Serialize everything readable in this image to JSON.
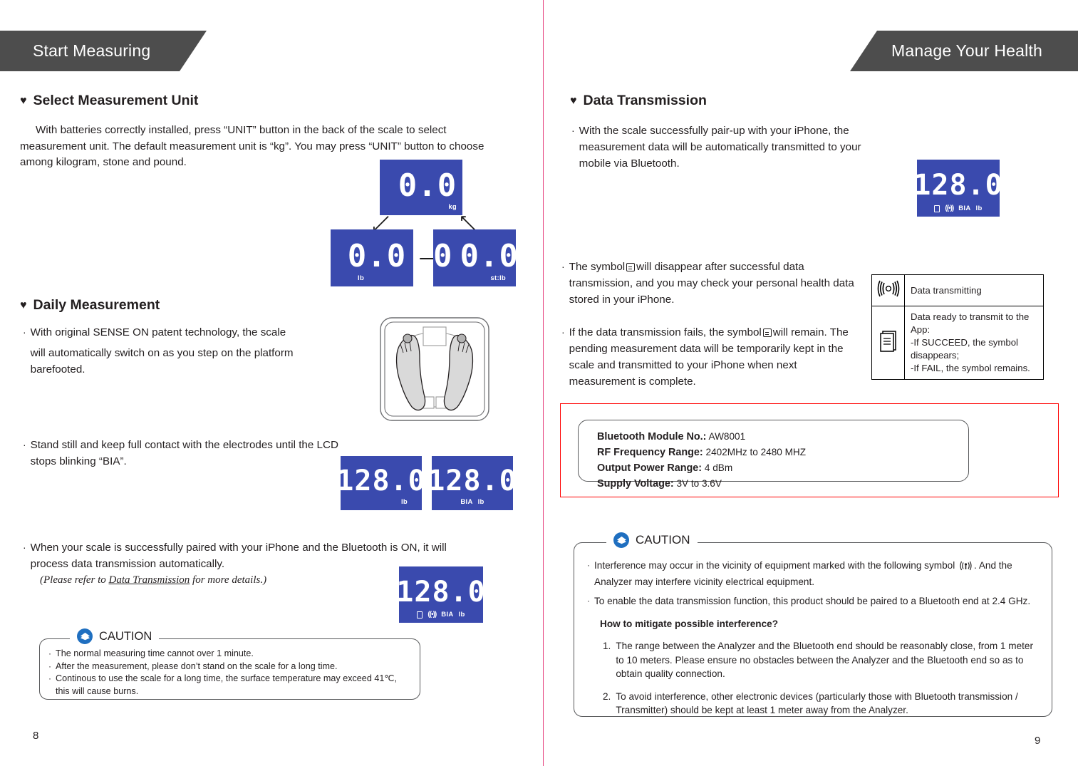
{
  "colors": {
    "banner_bg": "#4D4D4D",
    "lcd_blue": "#3A4AAE",
    "caution_icon_blue": "#1F6FC0",
    "spec_border_red": "#FF0000",
    "spine_pink": "#E6417F"
  },
  "left_page": {
    "banner_title": "Start Measuring",
    "page_number": "8",
    "section_unit": {
      "heading": "Select Measurement Unit",
      "paragraph": "With batteries correctly installed, press “UNIT” button in the back of the scale to select measurement unit. The default measurement unit is “kg”. You may press “UNIT” button to choose among kilogram, stone and pound.",
      "lcd_kg": {
        "value": "0.0",
        "unit": "kg"
      },
      "lcd_lb": {
        "value": "0.0",
        "unit": "lb"
      },
      "lcd_stlb": {
        "value_st": "0",
        "value_lb": "0.0",
        "unit": "st:lb"
      }
    },
    "section_daily": {
      "heading": "Daily Measurement",
      "bullet_1": "With original SENSE ON patent technology, the scale",
      "bullet_1b": "will automatically switch on as you step on the platform barefooted.",
      "bullet_2": "Stand still and keep full contact with the electrodes until the LCD stops blinking “BIA”.",
      "bullet_3": "When your scale is successfully paired with your iPhone and the Bluetooth is ON, it will process data transmission automatically.",
      "note_prefix": "(Please refer to ",
      "note_link": "Data Transmission",
      "note_suffix": " for more details.)",
      "lcd_weight": {
        "value": "128.0",
        "unit": "lb"
      },
      "lcd_weight_bia": {
        "value": "128.0",
        "bia": "BIA",
        "unit": "lb"
      },
      "lcd_paired": {
        "value": "128.0",
        "bia": "BIA",
        "unit": "lb"
      }
    },
    "caution": {
      "title": "CAUTION",
      "items": [
        "The normal measuring time  cannot over 1 minute.",
        "After the measurement, please don’t stand on the scale for a long time.",
        "Continous to use the scale for a long time, the surface temperature may exceed 41℃, this will cause burns."
      ]
    }
  },
  "right_page": {
    "banner_title": "Manage Your Health",
    "page_number": "9",
    "section_data": {
      "heading": "Data Transmission",
      "bullet_1": "With the scale successfully pair-up with your iPhone, the measurement data will be automatically transmitted to your mobile via Bluetooth.",
      "bullet_2_a": "The symbol",
      "bullet_2_b": "will disappear after successful data transmission, and you may check your personal health data stored in your iPhone.",
      "bullet_3_a": "If the data transmission fails, the symbol",
      "bullet_3_b": "will remain. The pending measurement data will be temporarily kept in the scale and transmitted to your iPhone when next measurement is complete.",
      "lcd_transmit": {
        "value": "128.0",
        "bia": "BIA",
        "unit": "lb"
      }
    },
    "symbol_table": {
      "rows": [
        {
          "icon": "data-transmitting-icon",
          "text": "Data transmitting"
        },
        {
          "icon": "document-pending-icon",
          "text": "Data ready to transmit to the App:\n-If SUCCEED, the symbol disappears;\n-If FAIL, the symbol remains."
        }
      ]
    },
    "spec_box": {
      "lines": [
        {
          "label": "Bluetooth Module No.:",
          "value": "AW8001"
        },
        {
          "label": "RF Frequency Range:",
          "value": "2402MHz to 2480 MHZ"
        },
        {
          "label": "Output Power Range:",
          "value": "4 dBm"
        },
        {
          "label": "Supply Voltage:",
          "value": "3V to 3.6V"
        }
      ]
    },
    "caution": {
      "title": "CAUTION",
      "bullet_1_a": "Interference may occur in the vicinity of equipment marked with the following symbol",
      "bullet_1_b": ". And the Analyzer may interfere vicinity electrical equipment.",
      "bullet_2": "To enable the data transmission function, this product should be paired to a Bluetooth end at 2.4 GHz.",
      "subheading": "How to mitigate possible interference?",
      "numbered": [
        {
          "n": "1.",
          "text": "The range between the Analyzer and the Bluetooth end should be reasonably close, from 1 meter to 10 meters. Please ensure no obstacles between the Analyzer and the Bluetooth end so as to obtain quality connection."
        },
        {
          "n": "2.",
          "text": "To avoid interference, other electronic devices (particularly those with Bluetooth transmission / Transmitter) should be kept at least 1 meter away from the Analyzer."
        }
      ]
    }
  },
  "icons": {
    "heart": "♥",
    "arrow_right": "➤",
    "wave": "((•))"
  }
}
